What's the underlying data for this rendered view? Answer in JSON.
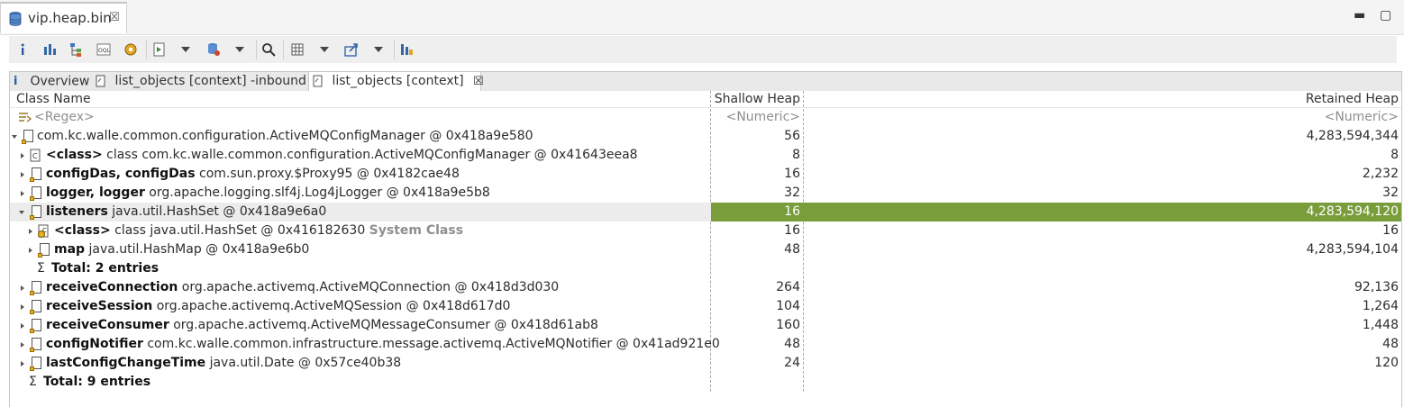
{
  "editor": {
    "tab_title": "vip.heap.bin",
    "close_glyph": "☒"
  },
  "window_controls": {
    "minimize": "▬",
    "maximize": "▢"
  },
  "toolbar": {
    "icons": [
      "info-icon",
      "histogram-icon",
      "dominator-tree-icon",
      "oql-icon",
      "thread-overview-icon",
      "run-report-icon",
      "query-browser-icon",
      "search-icon",
      "heap-calc-icon",
      "export-icon",
      "group-by-icon"
    ]
  },
  "inner_tabs": [
    {
      "label": "Overview"
    },
    {
      "label": "list_objects [context] -inbound"
    },
    {
      "label": "list_objects [context]",
      "close": "☒"
    }
  ],
  "columns": {
    "name": "Class Name",
    "shallow": "Shallow Heap",
    "retained": "Retained Heap"
  },
  "filter_row": {
    "name": "<Regex>",
    "shallow": "<Numeric>",
    "retained": "<Numeric>"
  },
  "rows": [
    {
      "bold": "",
      "text": "com.kc.walle.common.configuration.ActiveMQConfigManager @ 0x418a9e580",
      "suffix": "",
      "shallow": "56",
      "retained": "4,283,594,344"
    },
    {
      "bold": "<class>",
      "text": " class com.kc.walle.common.configuration.ActiveMQConfigManager @ 0x41643eea8",
      "suffix": "",
      "shallow": "8",
      "retained": "8"
    },
    {
      "bold": "configDas, configDas",
      "text": " com.sun.proxy.$Proxy95 @ 0x4182cae48",
      "suffix": "",
      "shallow": "16",
      "retained": "2,232"
    },
    {
      "bold": "logger, logger",
      "text": " org.apache.logging.slf4j.Log4jLogger @ 0x418a9e5b8",
      "suffix": "",
      "shallow": "32",
      "retained": "32"
    },
    {
      "bold": "listeners",
      "text": " java.util.HashSet @ 0x418a9e6a0",
      "suffix": "",
      "shallow": "16",
      "retained": "4,283,594,120"
    },
    {
      "bold": "<class>",
      "text": " class java.util.HashSet @ 0x416182630 ",
      "suffix": "System Class",
      "shallow": "16",
      "retained": "16"
    },
    {
      "bold": "map",
      "text": " java.util.HashMap @ 0x418a9e6b0",
      "suffix": "",
      "shallow": "48",
      "retained": "4,283,594,104"
    },
    {
      "bold": "Total: 2 entries",
      "text": "",
      "suffix": "",
      "shallow": "",
      "retained": ""
    },
    {
      "bold": "receiveConnection",
      "text": " org.apache.activemq.ActiveMQConnection @ 0x418d3d030",
      "suffix": "",
      "shallow": "264",
      "retained": "92,136"
    },
    {
      "bold": "receiveSession",
      "text": " org.apache.activemq.ActiveMQSession @ 0x418d617d0",
      "suffix": "",
      "shallow": "104",
      "retained": "1,264"
    },
    {
      "bold": "receiveConsumer",
      "text": " org.apache.activemq.ActiveMQMessageConsumer @ 0x418d61ab8",
      "suffix": "",
      "shallow": "160",
      "retained": "1,448"
    },
    {
      "bold": "configNotifier",
      "text": " com.kc.walle.common.infrastructure.message.activemq.ActiveMQNotifier @ 0x41ad921e0",
      "suffix": "",
      "shallow": "48",
      "retained": "48"
    },
    {
      "bold": "lastConfigChangeTime",
      "text": " java.util.Date @ 0x57ce40b38",
      "suffix": "",
      "shallow": "24",
      "retained": "120"
    },
    {
      "bold": "Total: 9 entries",
      "text": "",
      "suffix": "",
      "shallow": "",
      "retained": ""
    }
  ],
  "sigma": "Σ",
  "colors": {
    "selection_fill": "#7a9d3c",
    "row_highlight": "#ececec"
  }
}
